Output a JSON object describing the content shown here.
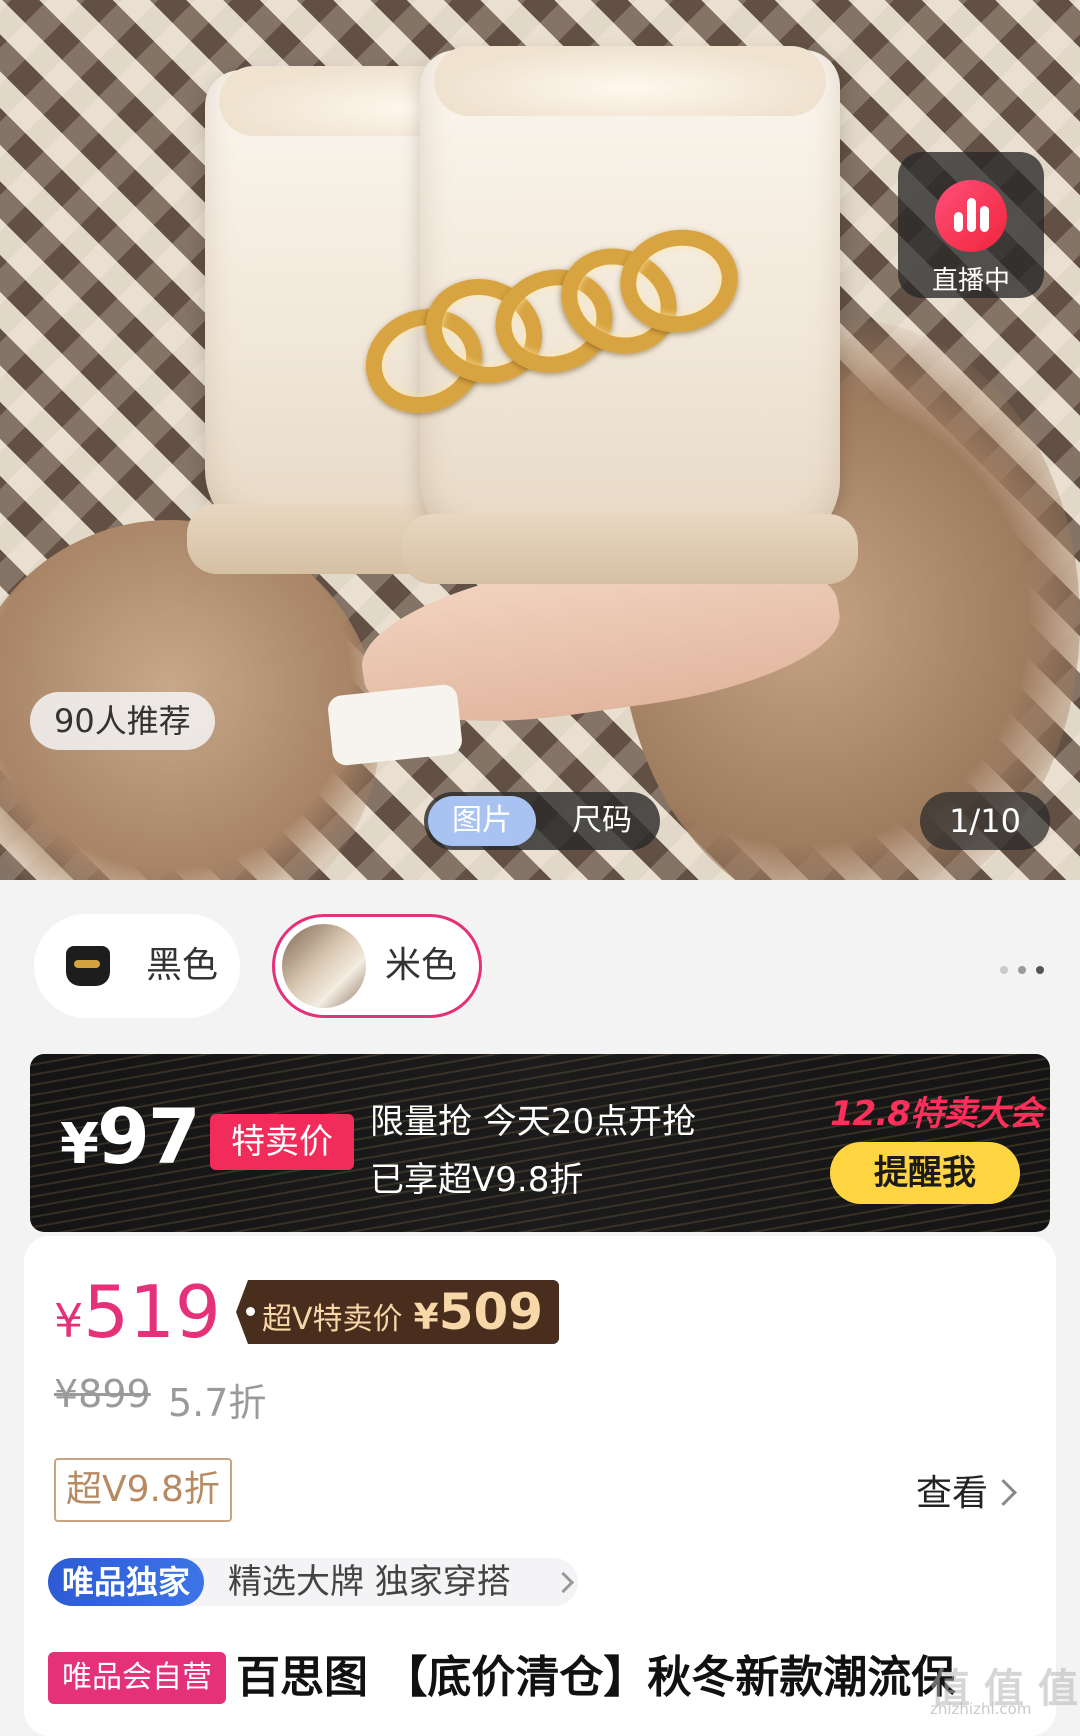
{
  "hero": {
    "live_badge": {
      "icon": "live-bars-icon",
      "label": "直播中"
    },
    "recommend_count": "90人推荐",
    "media_tabs": [
      {
        "label": "图片",
        "active": true
      },
      {
        "label": "尺码",
        "active": false
      }
    ],
    "page_counter": "1/10"
  },
  "colors": {
    "options": [
      {
        "label": "黑色",
        "selected": false
      },
      {
        "label": "米色",
        "selected": true
      }
    ],
    "more_icon": "more-dots-icon",
    "selected_border": "#e5317a"
  },
  "flash_sale": {
    "price_symbol": "¥",
    "price": "97",
    "tag": "特卖价",
    "line1": "限量抢 今天20点开抢",
    "line2": "已享超V9.8折",
    "event_name": "12.8特卖大会",
    "remind_label": "提醒我",
    "accent": "#f22c5a",
    "button_color": "#ffd641"
  },
  "pricing": {
    "currency": "¥",
    "current_price": "519",
    "svip_label": "超V特卖价",
    "svip_price": "509",
    "original_price": "¥899",
    "discount": "5.7折",
    "svip_coupon": "超V9.8折",
    "view_label": "查看",
    "price_color": "#e5317a"
  },
  "vip_exclusive": {
    "badge": "唯品独家",
    "text": "精选大牌  独家穿搭"
  },
  "product": {
    "self_run_badge": "唯品会自营",
    "title": "百思图 【底价清仓】秋冬新款潮流保"
  },
  "watermark": {
    "text": "值 值 值",
    "url": "zhizhizhi.com"
  }
}
